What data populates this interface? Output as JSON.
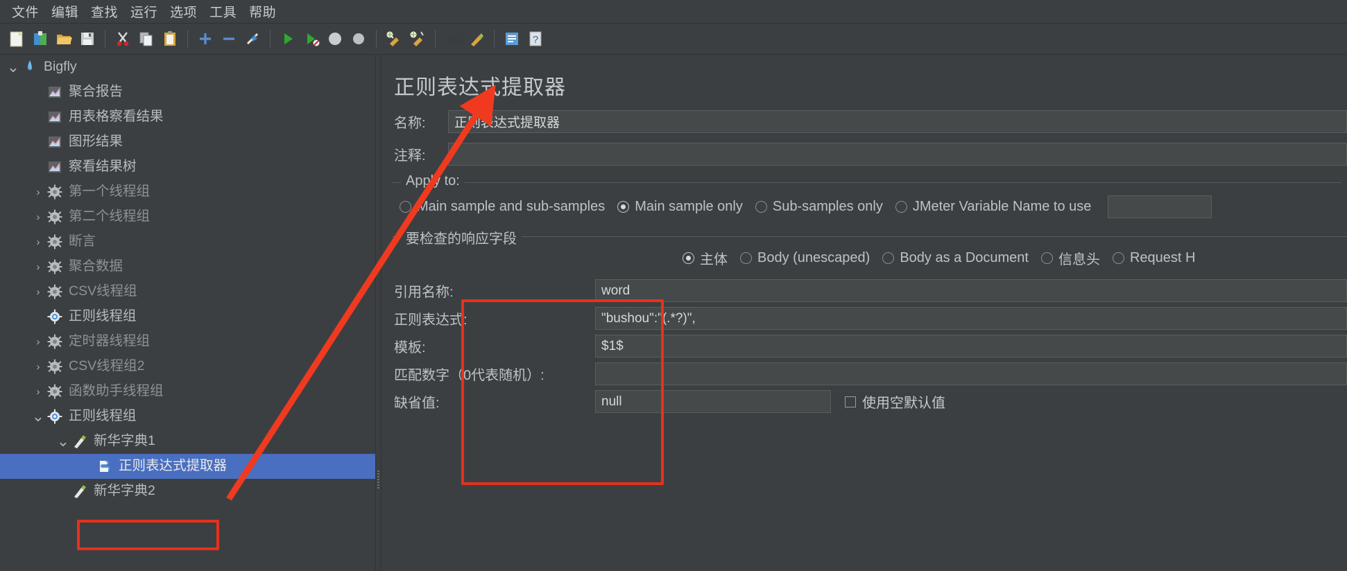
{
  "menubar": {
    "items": [
      {
        "label": "文件"
      },
      {
        "label": "编辑"
      },
      {
        "label": "查找"
      },
      {
        "label": "运行"
      },
      {
        "label": "选项"
      },
      {
        "label": "工具"
      },
      {
        "label": "帮助"
      }
    ]
  },
  "toolbar": {
    "buttons": [
      {
        "name": "new-icon",
        "glyph": "📄"
      },
      {
        "name": "templates-icon",
        "glyph": "📗"
      },
      {
        "name": "open-icon",
        "glyph": "📂"
      },
      {
        "name": "save-icon",
        "glyph": "💾"
      },
      {
        "name": "cut-icon",
        "glyph": "✂"
      },
      {
        "name": "copy-icon",
        "glyph": "📑"
      },
      {
        "name": "paste-icon",
        "glyph": "📋"
      },
      {
        "name": "expand-all-icon",
        "glyph": "+"
      },
      {
        "name": "collapse-all-icon",
        "glyph": "−"
      },
      {
        "name": "toggle-icon",
        "glyph": "⚡"
      },
      {
        "name": "start-icon",
        "glyph": "▶"
      },
      {
        "name": "start-no-pauses-icon",
        "glyph": "▶"
      },
      {
        "name": "stop-icon",
        "glyph": "⬤"
      },
      {
        "name": "shutdown-icon",
        "glyph": "⬤"
      },
      {
        "name": "clear-icon",
        "glyph": "🧹"
      },
      {
        "name": "clear-all-icon",
        "glyph": "🧹"
      },
      {
        "name": "search-icon",
        "glyph": "👓"
      },
      {
        "name": "reset-search-icon",
        "glyph": "🖌"
      },
      {
        "name": "function-helper-icon",
        "glyph": "📗"
      },
      {
        "name": "help-icon",
        "glyph": "?"
      }
    ]
  },
  "sidebar": {
    "items": [
      {
        "label": "Bigfly",
        "depth": 0,
        "twisty": "expanded",
        "icon": "jmeter-icon",
        "dim": false,
        "selected": false
      },
      {
        "label": "聚合报告",
        "depth": 1,
        "twisty": "none",
        "icon": "report-icon",
        "dim": false,
        "selected": false
      },
      {
        "label": "用表格察看结果",
        "depth": 1,
        "twisty": "none",
        "icon": "report-icon",
        "dim": false,
        "selected": false
      },
      {
        "label": "图形结果",
        "depth": 1,
        "twisty": "none",
        "icon": "report-icon",
        "dim": false,
        "selected": false
      },
      {
        "label": "察看结果树",
        "depth": 1,
        "twisty": "none",
        "icon": "report-icon",
        "dim": false,
        "selected": false
      },
      {
        "label": "第一个线程组",
        "depth": 1,
        "twisty": "collapsed",
        "icon": "threadgroup-icon",
        "dim": true,
        "selected": false
      },
      {
        "label": "第二个线程组",
        "depth": 1,
        "twisty": "collapsed",
        "icon": "threadgroup-icon",
        "dim": true,
        "selected": false
      },
      {
        "label": "断言",
        "depth": 1,
        "twisty": "collapsed",
        "icon": "threadgroup-icon",
        "dim": true,
        "selected": false
      },
      {
        "label": "聚合数据",
        "depth": 1,
        "twisty": "collapsed",
        "icon": "threadgroup-icon",
        "dim": true,
        "selected": false
      },
      {
        "label": "CSV线程组",
        "depth": 1,
        "twisty": "collapsed",
        "icon": "threadgroup-icon",
        "dim": true,
        "selected": false
      },
      {
        "label": "正则线程组",
        "depth": 1,
        "twisty": "none",
        "icon": "threadgroup-active-icon",
        "dim": false,
        "selected": false
      },
      {
        "label": "定时器线程组",
        "depth": 1,
        "twisty": "collapsed",
        "icon": "threadgroup-icon",
        "dim": true,
        "selected": false
      },
      {
        "label": "CSV线程组2",
        "depth": 1,
        "twisty": "collapsed",
        "icon": "threadgroup-icon",
        "dim": true,
        "selected": false
      },
      {
        "label": "函数助手线程组",
        "depth": 1,
        "twisty": "collapsed",
        "icon": "threadgroup-icon",
        "dim": true,
        "selected": false
      },
      {
        "label": "正则线程组",
        "depth": 1,
        "twisty": "expanded",
        "icon": "threadgroup-active-icon",
        "dim": false,
        "selected": false
      },
      {
        "label": "新华字典1",
        "depth": 2,
        "twisty": "expanded",
        "icon": "http-sampler-icon",
        "dim": false,
        "selected": false
      },
      {
        "label": "正则表达式提取器",
        "depth": 3,
        "twisty": "none",
        "icon": "post-processor-icon",
        "dim": false,
        "selected": true
      },
      {
        "label": "新华字典2",
        "depth": 2,
        "twisty": "none",
        "icon": "http-sampler-icon",
        "dim": false,
        "selected": false
      }
    ]
  },
  "panel": {
    "title": "正则表达式提取器",
    "name_label": "名称:",
    "name_value": "正则表达式提取器",
    "comment_label": "注释:",
    "comment_value": "",
    "apply_to": {
      "legend": "Apply to:",
      "options": [
        {
          "label": "Main sample and sub-samples",
          "checked": false
        },
        {
          "label": "Main sample only",
          "checked": true
        },
        {
          "label": "Sub-samples only",
          "checked": false
        },
        {
          "label": "JMeter Variable Name to use",
          "checked": false
        }
      ],
      "variable_value": ""
    },
    "response_field": {
      "legend": "要检查的响应字段",
      "options": [
        {
          "label": "主体",
          "checked": true
        },
        {
          "label": "Body (unescaped)",
          "checked": false
        },
        {
          "label": "Body as a Document",
          "checked": false
        },
        {
          "label": "信息头",
          "checked": false
        },
        {
          "label": "Request H",
          "checked": false
        }
      ]
    },
    "fields": [
      {
        "label": "引用名称:",
        "value": "word"
      },
      {
        "label": "正则表达式:",
        "value": "\"bushou\":\"(.*?)\","
      },
      {
        "label": "模板:",
        "value": "$1$"
      },
      {
        "label": "匹配数字（0代表随机）:",
        "value": ""
      },
      {
        "label": "缺省值:",
        "value": "null"
      }
    ],
    "use_empty_default_label": "使用空默认值",
    "use_empty_default_checked": false
  },
  "annotations": {
    "highlight_color": "#e8301c",
    "selection_color": "#4a6fc0"
  }
}
